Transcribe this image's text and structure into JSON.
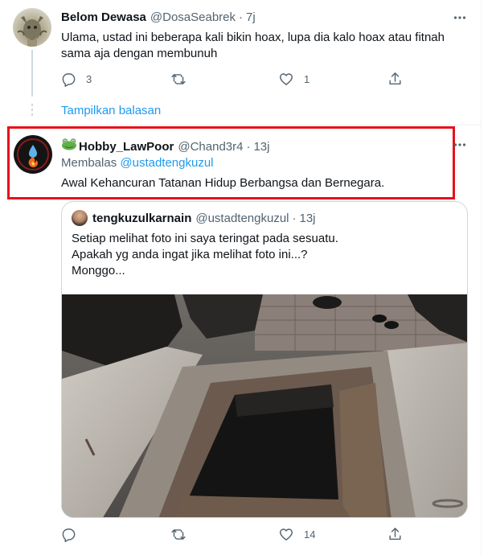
{
  "tweet1": {
    "display_name": "Belom Dewasa",
    "handle": "@DosaSeabrek",
    "time": "7j",
    "text_lines": [
      "Ulama, ustad ini beberapa kali bikin hoax, lupa dia kalo hoax atau fitnah",
      "sama aja dengan membunuh"
    ],
    "reply_count": "3",
    "retweet_count": "",
    "like_count": "1",
    "show_replies_label": "Tampilkan balasan"
  },
  "tweet2": {
    "display_name": "Hobby_LawPoor",
    "handle": "@Chand3r4",
    "time": "13j",
    "replying_prefix": "Membalas",
    "replying_to": "@ustadtengkuzul",
    "text": "Awal Kehancuran Tatanan Hidup Berbangsa dan Bernegara.",
    "reply_count": "",
    "retweet_count": "",
    "like_count": "14",
    "highlight_color": "#e8101a"
  },
  "quoted": {
    "display_name": "tengkuzulkarnain",
    "handle": "@ustadtengkuzul",
    "time": "13j",
    "text_lines": [
      "Setiap melihat foto ini saya teringat pada sesuatu.",
      "Apakah yg anda ingat jika melihat foto ini...?",
      "Monggo..."
    ]
  },
  "separator": "·",
  "colors": {
    "accent": "#1d9bf0",
    "secondary_text": "#536471",
    "border": "#cfd9de"
  },
  "icons": [
    "reply-icon",
    "retweet-icon",
    "like-icon",
    "share-icon",
    "more-icon",
    "frog-emoji",
    "water-drop-icon",
    "fire-icon"
  ]
}
